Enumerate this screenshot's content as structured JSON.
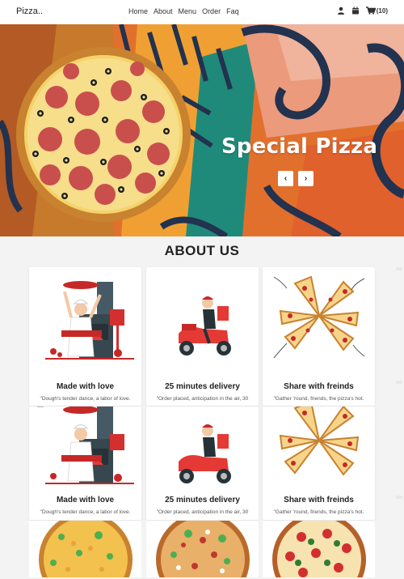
{
  "nav": {
    "brand": "Pizza..",
    "menu": [
      "Home",
      "About",
      "Menu",
      "Order",
      "Faq"
    ],
    "cart_count": "(10)",
    "icons": [
      "user-icon",
      "calendar-icon",
      "cart-icon"
    ]
  },
  "hero": {
    "title": "Special Pizza",
    "prev": "‹",
    "next": "›"
  },
  "about": {
    "title": "ABOUT US",
    "cards": [
      {
        "title": "Made with love",
        "desc": "\"Dough's tender dance, a labor of love."
      },
      {
        "title": "25 minutes delivery",
        "desc": "\"Order placed, anticipation in the air, 30"
      },
      {
        "title": "Share with freinds",
        "desc": "\"Gather 'round, friends, the pizza's hot."
      }
    ]
  },
  "colors": {
    "accent_red": "#d9312b",
    "dark": "#37474f",
    "hero_orange": "#e06b2a"
  }
}
